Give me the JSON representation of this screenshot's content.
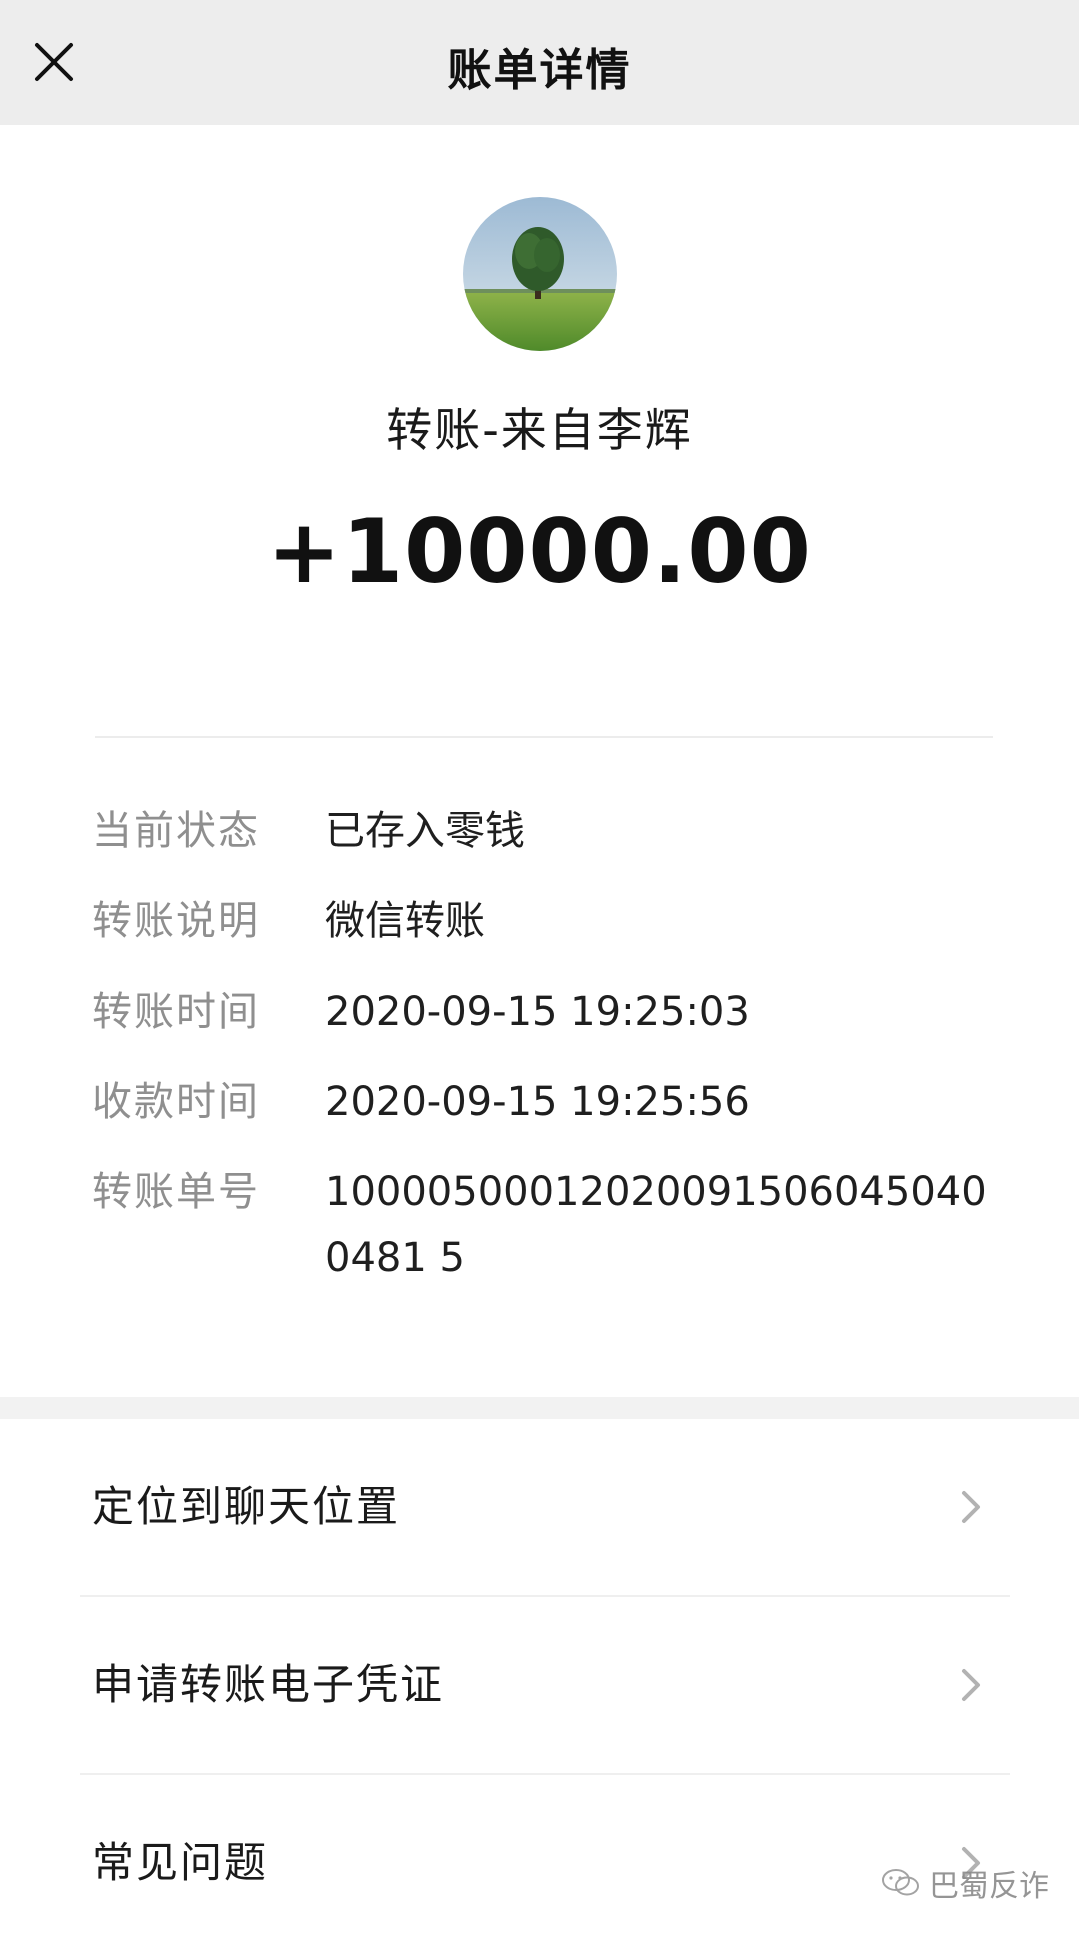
{
  "header": {
    "title": "账单详情",
    "close_icon": "close-icon"
  },
  "summary": {
    "avatar_icon": "tree-landscape-avatar",
    "payer_text": "转账-来自李辉",
    "amount": "+10000.00"
  },
  "details": [
    {
      "label": "当前状态",
      "value": "已存入零钱"
    },
    {
      "label": "转账说明",
      "value": "微信转账"
    },
    {
      "label": "转账时间",
      "value": "2020-09-15 19:25:03"
    },
    {
      "label": "收款时间",
      "value": "2020-09-15 19:25:56"
    },
    {
      "label": "转账单号",
      "value": "100005000120200915060450400481 5"
    }
  ],
  "actions": [
    {
      "label": "定位到聊天位置",
      "icon": "chevron-right-icon"
    },
    {
      "label": "申请转账电子凭证",
      "icon": "chevron-right-icon"
    },
    {
      "label": "常见问题",
      "icon": "chevron-right-icon"
    }
  ],
  "watermark": {
    "text": "巴蜀反诈",
    "icon": "wechat-icon"
  },
  "colors": {
    "header_bg": "#ededed",
    "label_gray": "#8f8f8f",
    "text_dark": "#1a1a1a"
  }
}
